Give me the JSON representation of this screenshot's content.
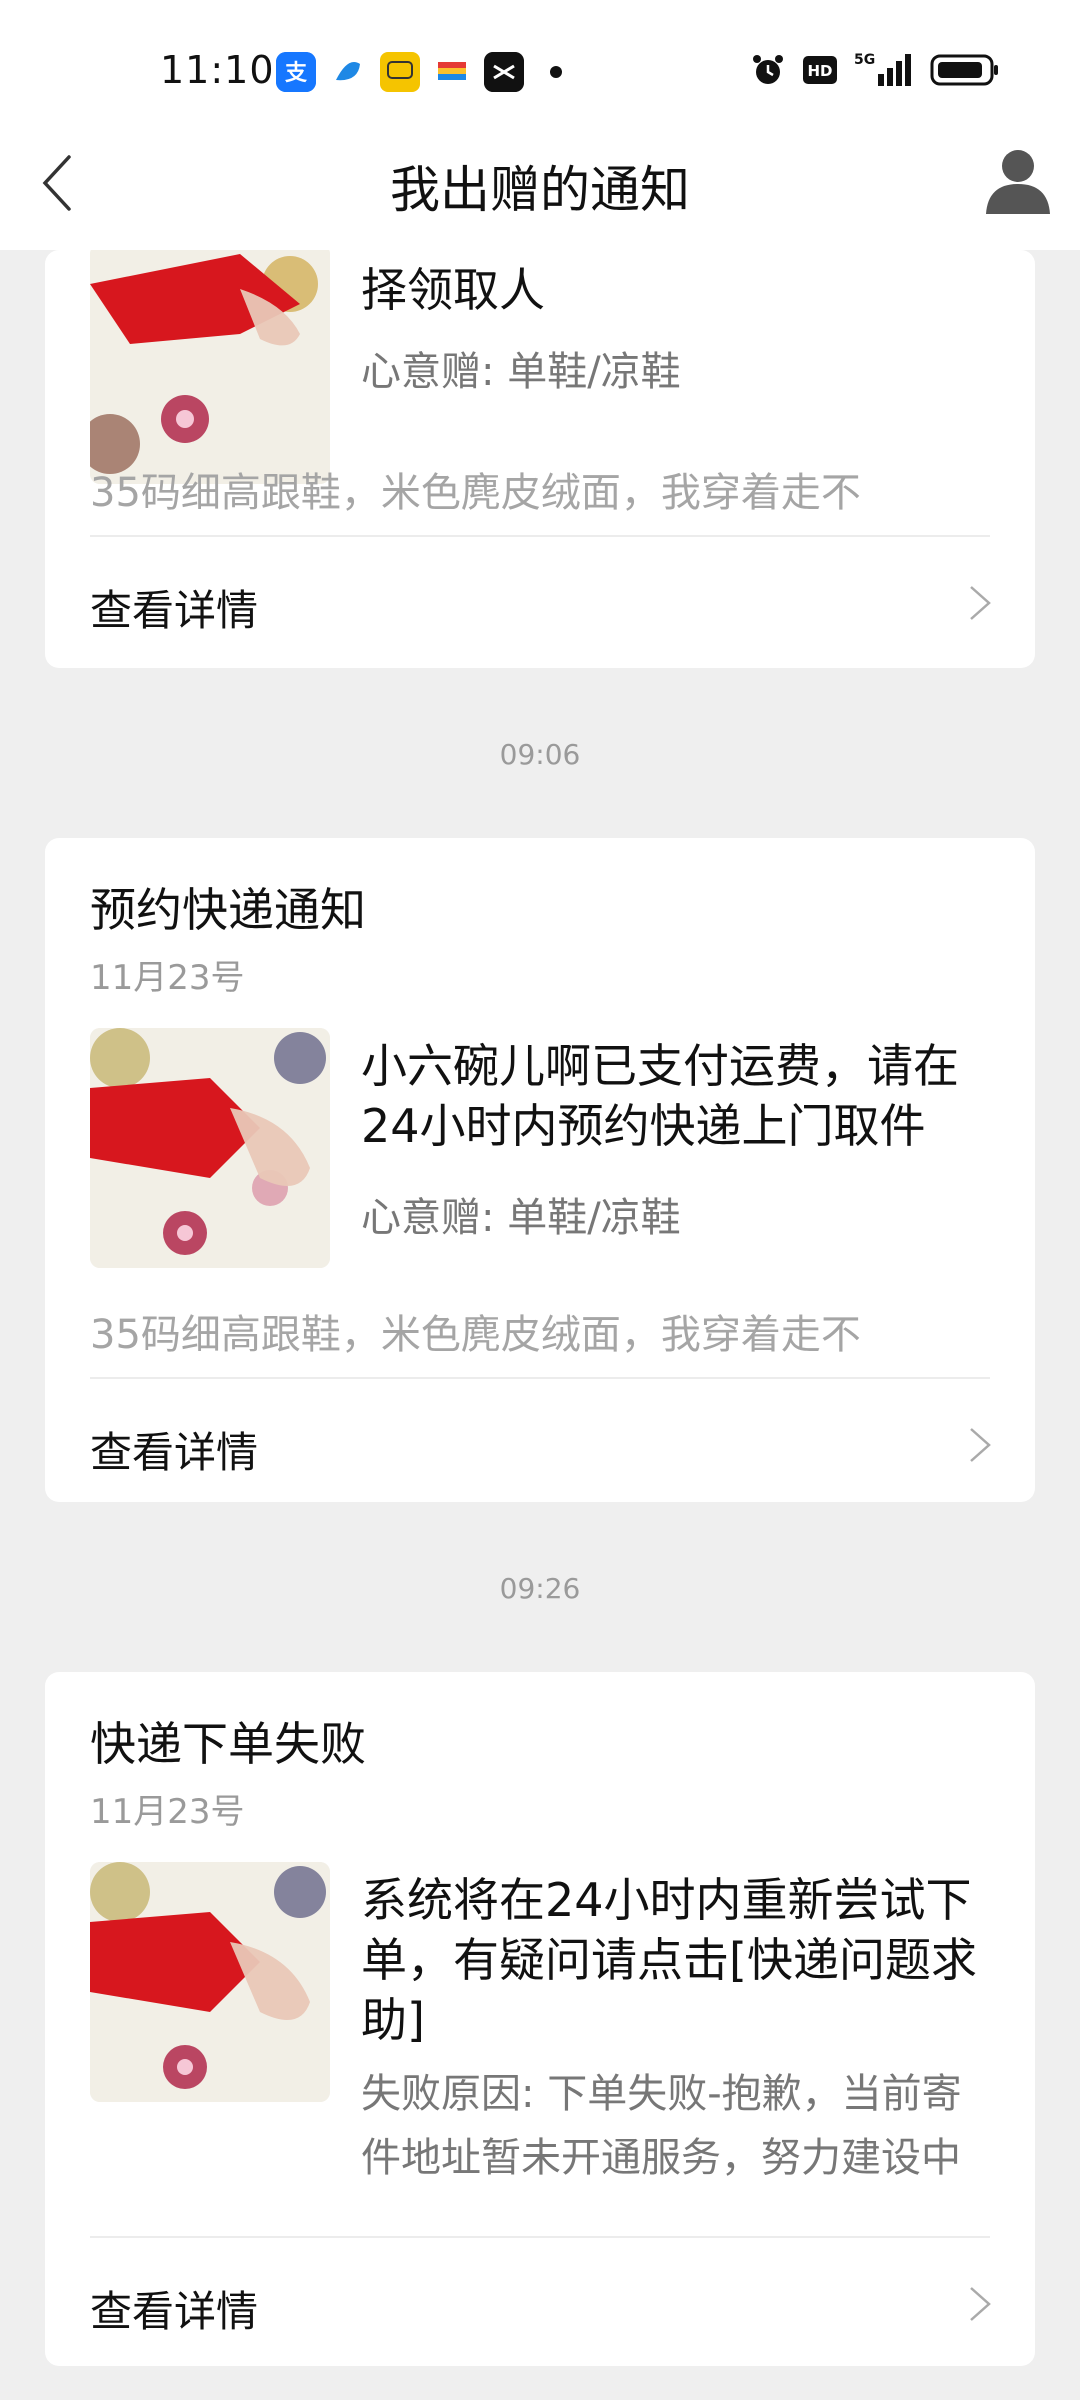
{
  "status_bar": {
    "time": "11:10",
    "app_icons": [
      "alipay-icon",
      "blue-app-icon",
      "gamepad-app-icon",
      "wallet-icon",
      "capcut-icon"
    ],
    "indicators": [
      "alarm-icon",
      "hd-icon",
      "5g-signal-icon",
      "battery-icon"
    ],
    "hd_label": "HD",
    "network_label": "5G"
  },
  "header": {
    "title": "我出赠的通知",
    "back_icon": "chevron-left-icon",
    "user_icon": "user-icon"
  },
  "cards": [
    {
      "title": "",
      "date": "",
      "message": "择领取人",
      "sub": "心意赠: 单鞋/凉鞋",
      "preview": "35码细高跟鞋，米色麂皮绒面，我穿着走不",
      "detail_label": "查看详情"
    },
    {
      "time_label": "09:06",
      "title": "预约快递通知",
      "date": "11月23号",
      "message": "小六碗儿啊已支付运费，请在24小时内预约快递上门取件",
      "sub": "心意赠: 单鞋/凉鞋",
      "preview": "35码细高跟鞋，米色麂皮绒面，我穿着走不",
      "detail_label": "查看详情"
    },
    {
      "time_label": "09:26",
      "title": "快递下单失败",
      "date": "11月23号",
      "message": "系统将在24小时内重新尝试下单，有疑问请点击[快递问题求助]",
      "sub": "失败原因: 下单失败-抱歉，当前寄件地址暂未开通服务，努力建设中",
      "detail_label": "查看详情"
    }
  ],
  "colors": {
    "background": "#efefef",
    "card": "#ffffff",
    "muted_text": "#9a9a9a"
  }
}
